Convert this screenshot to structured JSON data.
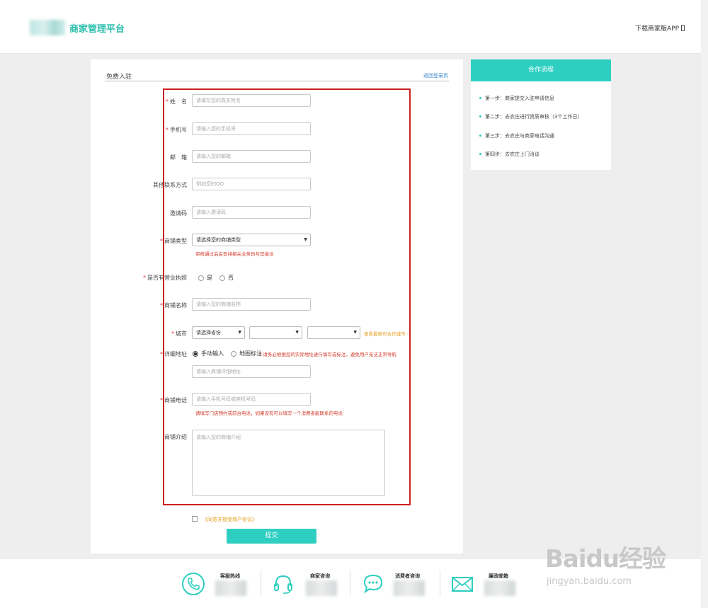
{
  "header": {
    "brand_title": "商家管理平台",
    "download_label": "下载商家版APP"
  },
  "form": {
    "section_title": "免费入驻",
    "back_login": "返回登录页",
    "fields": {
      "name": {
        "label": "姓　名",
        "placeholder": "请填写您的真实姓名"
      },
      "phone": {
        "label": "手机号",
        "placeholder": "请输入您的手机号"
      },
      "email": {
        "label": "邮　箱",
        "placeholder": "请输入您的邮箱"
      },
      "other_contact": {
        "label": "其他联系方式",
        "placeholder": "例如您的QQ"
      },
      "invite_code": {
        "label": "邀请码",
        "placeholder": "请输入邀请码"
      },
      "shop_type": {
        "label": "商铺类型",
        "value": "请选择您的商铺类型",
        "hint": "审核通过后会安排相关业务员与您接洽"
      },
      "license": {
        "label": "是否有营业执照",
        "options": [
          "是",
          "否"
        ]
      },
      "shop_name": {
        "label": "商铺名称",
        "placeholder": "请输入您的商铺名称"
      },
      "city": {
        "label": "城市",
        "province_value": "请选择省份",
        "hint": "查看最新可合作城市"
      },
      "address": {
        "label": "详细地址",
        "options": [
          "手动输入",
          "地图标注"
        ],
        "hint": "* 请务必根据您的实际地址进行填写或标注，避免用户无法正常导航",
        "placeholder": "请输入商铺详细地址"
      },
      "shop_phone": {
        "label": "商铺电话",
        "placeholder": "请输入手机号码或座机号码",
        "hint": "请填写门店预约或前台电话，如果没有可以填写一个消费者能联系的电话"
      },
      "intro": {
        "label": "商铺介绍",
        "placeholder": "请输入您的商铺介绍"
      }
    },
    "agree_label": "《同意并接受商户协议》",
    "submit_label": "提交"
  },
  "process": {
    "title": "合作流程",
    "steps": [
      "第一步：商家提交入驻申请信息",
      "第二步：去农庄进行资质审核（3个工作日）",
      "第三步：去农庄与商家电话沟通",
      "第四步：去农庄上门洽谈"
    ]
  },
  "footer": {
    "items": [
      {
        "title": "客服热线",
        "icon": "phone-icon"
      },
      {
        "title": "商家咨询",
        "icon": "headset-icon"
      },
      {
        "title": "消费者咨询",
        "icon": "chat-icon"
      },
      {
        "title": "廉政邮箱",
        "icon": "mail-icon"
      }
    ]
  },
  "watermark": {
    "main": "Baidu经验",
    "sub": "jingyan.baidu.com"
  },
  "colors": {
    "accent": "#2ecfc0",
    "required": "#e0303a",
    "highlight_border": "#cc1f1f",
    "hint_orange": "#e6a020"
  }
}
